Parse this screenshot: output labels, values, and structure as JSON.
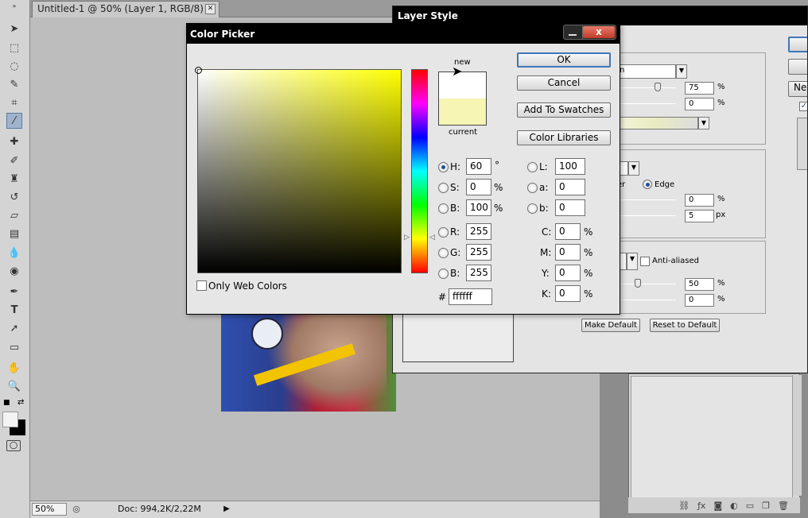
{
  "document": {
    "tab_title": "Untitled-1 @ 50% (Layer 1, RGB/8) *",
    "zoom": "50%",
    "doc_info": "Doc: 994,2K/2,22M"
  },
  "toolbox": {
    "tools": [
      "move-tool",
      "marquee-tool",
      "lasso-tool",
      "quick-selection-tool",
      "crop-tool",
      "eyedropper-tool",
      "healing-brush-tool",
      "brush-tool",
      "clone-stamp-tool",
      "history-brush-tool",
      "eraser-tool",
      "gradient-tool",
      "blur-tool",
      "dodge-tool",
      "pen-tool",
      "type-tool",
      "path-selection-tool",
      "shape-tool",
      "hand-tool",
      "zoom-tool"
    ]
  },
  "layer_style": {
    "title": "Layer Style",
    "new_style_label": "New",
    "opacity_value": "75",
    "noise_value": "0",
    "edge_label": "Edge",
    "center_label": "er",
    "choke_value": "0",
    "size_value": "5",
    "anti_aliased_label": "Anti-aliased",
    "range_value": "50",
    "jitter_value": "0",
    "percent": "%",
    "px": "px",
    "blend_mode_fragment": "n",
    "make_default_label": "Make Default",
    "reset_default_label": "Reset to Default"
  },
  "color_picker": {
    "title": "Color Picker",
    "close_label": "x",
    "new_label": "new",
    "current_label": "current",
    "ok_label": "OK",
    "cancel_label": "Cancel",
    "add_swatches_label": "Add To Swatches",
    "color_libraries_label": "Color Libraries",
    "only_web_colors_label": "Only Web Colors",
    "new_color": "#ffffff",
    "current_color": "#f6f5b3",
    "hsb": {
      "h_label": "H:",
      "h_value": "60",
      "h_unit": "°",
      "s_label": "S:",
      "s_value": "0",
      "s_unit": "%",
      "b_label": "B:",
      "b_value": "100",
      "b_unit": "%"
    },
    "rgb": {
      "r_label": "R:",
      "r_value": "255",
      "g_label": "G:",
      "g_value": "255",
      "b_label": "B:",
      "b_value": "255"
    },
    "lab": {
      "l_label": "L:",
      "l_value": "100",
      "a_label": "a:",
      "a_value": "0",
      "b_label": "b:",
      "b_value": "0"
    },
    "cmyk": {
      "c_label": "C:",
      "c_value": "0",
      "m_label": "M:",
      "m_value": "0",
      "y_label": "Y:",
      "y_value": "0",
      "k_label": "K:",
      "k_value": "0",
      "unit": "%"
    },
    "hex_label": "#",
    "hex_value": "ffffff"
  }
}
